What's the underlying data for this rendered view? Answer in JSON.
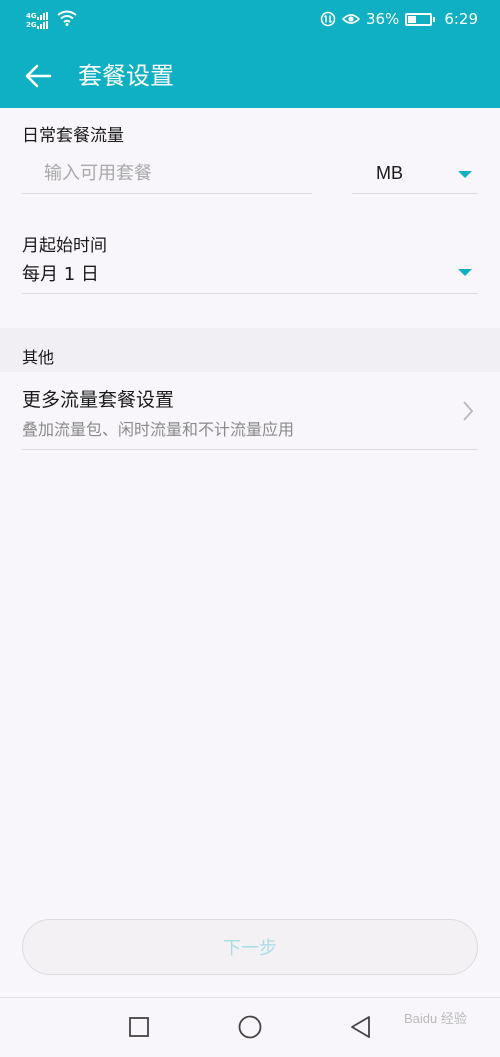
{
  "status_bar": {
    "network_a": "4G",
    "network_b": "2G",
    "battery_percent": "36%",
    "time": "6:29",
    "icons": [
      "signal-icon",
      "wifi-icon",
      "data-saver-icon",
      "eye-comfort-icon",
      "battery-icon"
    ]
  },
  "app_bar": {
    "title": "套餐设置"
  },
  "daily_quota": {
    "label": "日常套餐流量",
    "placeholder": "输入可用套餐",
    "value": "",
    "unit": "MB"
  },
  "month_start": {
    "label": "月起始时间",
    "value": "每月 1 日"
  },
  "other": {
    "header": "其他",
    "more_title": "更多流量套餐设置",
    "more_subtitle": "叠加流量包、闲时流量和不计流量应用"
  },
  "next_button": {
    "label": "下一步"
  },
  "watermark": "Baidu 经验",
  "colors": {
    "accent": "#0fb0c4",
    "background": "#f8f6fa",
    "disabled_text": "#a9dde4"
  }
}
